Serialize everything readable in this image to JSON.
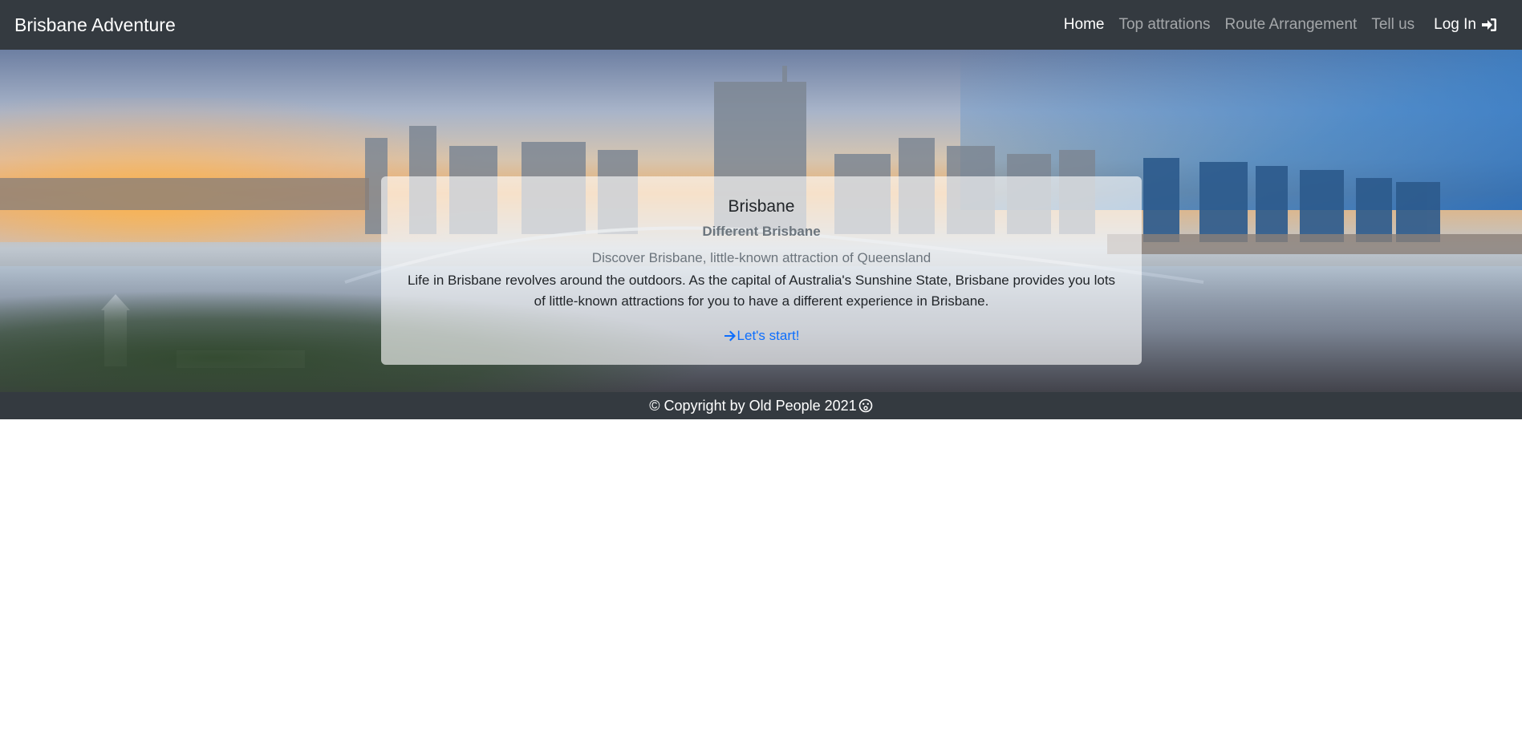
{
  "navbar": {
    "brand": "Brisbane Adventure",
    "links": [
      {
        "label": "Home",
        "active": true
      },
      {
        "label": "Top attrations",
        "active": false
      },
      {
        "label": "Route Arrangement",
        "active": false
      },
      {
        "label": "Tell us",
        "active": false
      }
    ],
    "login_label": "Log In",
    "login_icon": "sign-in-icon"
  },
  "hero": {
    "background": "Brisbane city skyline and river at sunset",
    "card": {
      "title": "Brisbane",
      "subtitle": "Different Brisbane",
      "tagline": "Discover Brisbane, little-known attraction of Queensland",
      "text": "Life in Brisbane revolves around the outdoors. As the capital of Australia's Sunshine State, Brisbane provides you lots of little-known attractions for you to have a different experience in Brisbane.",
      "cta_label": "Let's start!",
      "cta_icon": "arrow-right-icon"
    }
  },
  "footer": {
    "text": "© Copyright by Old People 2021",
    "icon": "surprised-face-icon"
  },
  "colors": {
    "navbar_bg": "#343a40",
    "link_accent": "#0d6efd",
    "muted_text": "#6c757d"
  }
}
